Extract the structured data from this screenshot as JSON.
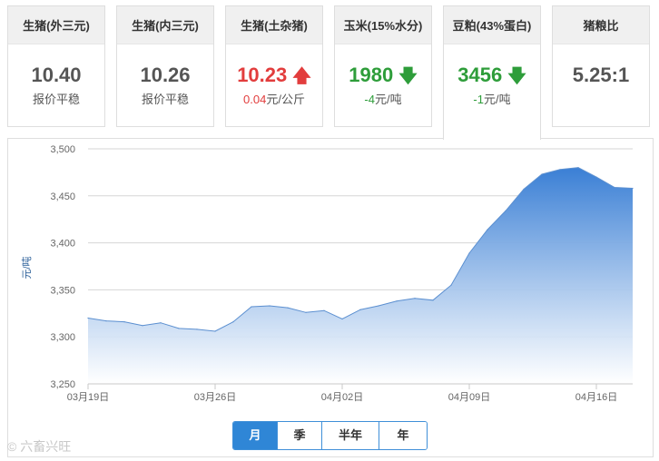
{
  "tabs": [
    {
      "title": "生猪(外三元)",
      "value": "10.40",
      "sub": "报价平稳",
      "trend": "flat"
    },
    {
      "title": "生猪(内三元)",
      "value": "10.26",
      "sub": "报价平稳",
      "trend": "flat"
    },
    {
      "title": "生猪(土杂猪)",
      "value": "10.23",
      "sub_num": "0.04",
      "sub_unit": "元/公斤",
      "trend": "up"
    },
    {
      "title": "玉米(15%水分)",
      "value": "1980",
      "sub_num": "-4",
      "sub_unit": "元/吨",
      "trend": "down"
    },
    {
      "title": "豆粕(43%蛋白)",
      "value": "3456",
      "sub_num": "-1",
      "sub_unit": "元/吨",
      "trend": "down",
      "active": true
    },
    {
      "title": "猪粮比",
      "value": "5.25:1",
      "sub": "",
      "trend": "flat"
    }
  ],
  "icons": {
    "up": "arrow-up-icon",
    "down": "arrow-down-icon"
  },
  "colors": {
    "up": "#e23d3d",
    "down": "#2e9d3a",
    "accent": "#2f86d6",
    "area_top": "#3a7fd5",
    "area_bottom": "#ffffff"
  },
  "periods": [
    "月",
    "季",
    "半年",
    "年"
  ],
  "active_period": "月",
  "watermark": "六畜兴旺",
  "chart_data": {
    "type": "area",
    "ylabel": "元/吨",
    "ylim": [
      3250,
      3500
    ],
    "yticks": [
      "3,250",
      "3,300",
      "3,350",
      "3,400",
      "3,450",
      "3,500"
    ],
    "xtick_labels": [
      "03月19日",
      "03月26日",
      "04月02日",
      "04月09日",
      "04月16日"
    ],
    "xtick_index": [
      0,
      7,
      14,
      21,
      28
    ],
    "values": [
      3320,
      3317,
      3316,
      3312,
      3315,
      3309,
      3308,
      3306,
      3316,
      3332,
      3333,
      3331,
      3326,
      3328,
      3319,
      3329,
      3333,
      3338,
      3341,
      3339,
      3355,
      3389,
      3414,
      3434,
      3457,
      3473,
      3478,
      3480,
      3470,
      3459,
      3458
    ]
  }
}
